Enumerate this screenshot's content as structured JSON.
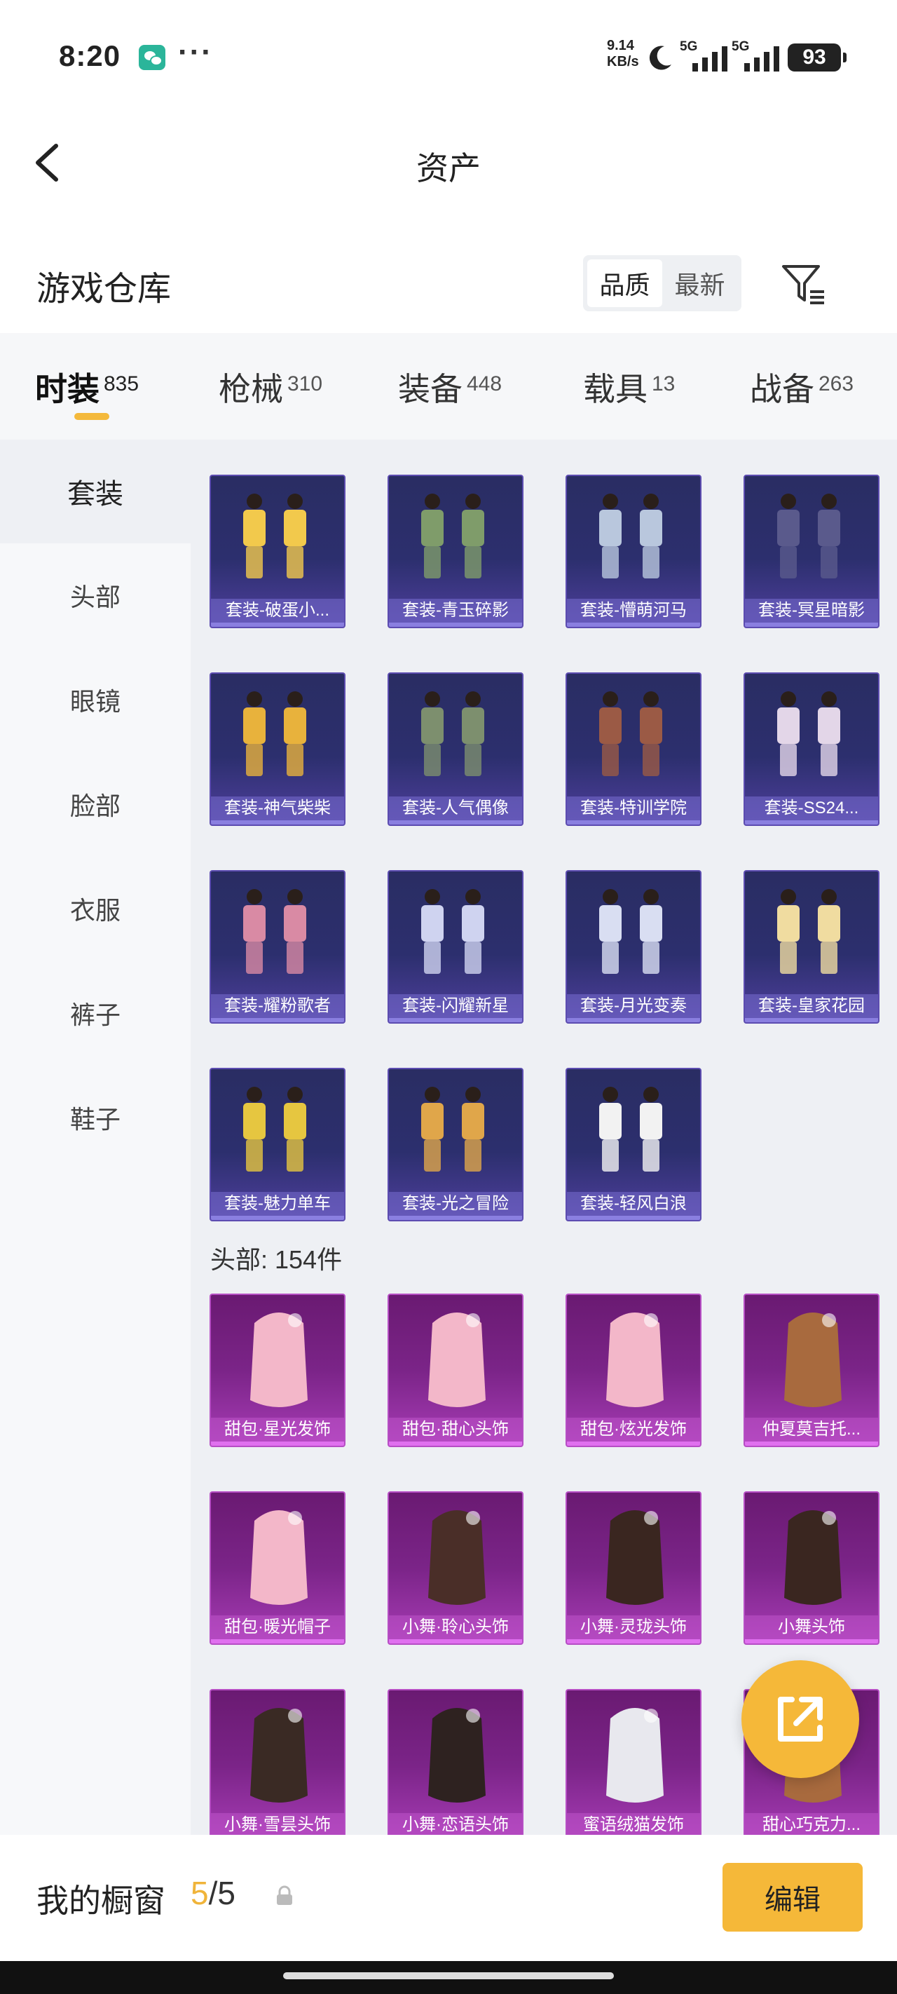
{
  "status_bar": {
    "time": "8:20",
    "dots": "···",
    "net_speed_value": "9.14",
    "net_speed_unit": "KB/s",
    "signal_1_label": "5G",
    "signal_2_label": "5G",
    "battery": "93",
    "icons": [
      "wechat-icon",
      "moon-icon",
      "signal-icon",
      "battery-icon"
    ]
  },
  "header": {
    "title": "资产",
    "back_icon": "chevron-left-icon"
  },
  "warehouse": {
    "title": "游戏仓库",
    "sort_options": [
      "品质",
      "最新"
    ],
    "sort_selected": "品质",
    "filter_icon": "filter-icon"
  },
  "tabs": [
    {
      "label": "时装",
      "count": "835",
      "active": true
    },
    {
      "label": "枪械",
      "count": "310",
      "active": false
    },
    {
      "label": "装备",
      "count": "448",
      "active": false
    },
    {
      "label": "载具",
      "count": "13",
      "active": false
    },
    {
      "label": "战备",
      "count": "263",
      "active": false
    }
  ],
  "sidebar": {
    "items": [
      {
        "label": "套装",
        "active": true
      },
      {
        "label": "头部",
        "active": false
      },
      {
        "label": "眼镜",
        "active": false
      },
      {
        "label": "脸部",
        "active": false
      },
      {
        "label": "衣服",
        "active": false
      },
      {
        "label": "裤子",
        "active": false
      },
      {
        "label": "鞋子",
        "active": false
      }
    ]
  },
  "suits": [
    "套装-破蛋小...",
    "套装-青玉碎影",
    "套装-懵萌河马",
    "套装-冥星暗影",
    "套装-神气柴柴",
    "套装-人气偶像",
    "套装-特训学院",
    "套装-SS24...",
    "套装-耀粉歌者",
    "套装-闪耀新星",
    "套装-月光变奏",
    "套装-皇家花园",
    "套装-魅力单车",
    "套装-光之冒险",
    "套装-轻风白浪"
  ],
  "head_section": {
    "label": "头部: 154件"
  },
  "head_items": [
    "甜包·星光发饰",
    "甜包·甜心头饰",
    "甜包·炫光发饰",
    "仲夏莫吉托...",
    "甜包·暖光帽子",
    "小舞·聆心头饰",
    "小舞·灵珑头饰",
    "小舞头饰",
    "小舞·雪昙头饰",
    "小舞·恋语头饰",
    "蜜语绒猫发饰",
    "甜心巧克力..."
  ],
  "fab": {
    "icon": "share-external-icon"
  },
  "bottom_bar": {
    "label": "我的橱窗",
    "count_current": "5",
    "count_separator": "/",
    "count_total": "5",
    "lock_icon": "lock-icon",
    "edit_label": "编辑"
  },
  "colors": {
    "accent": "#f5b839",
    "suit_card": "#2c2f6e",
    "head_card": "#7b2488",
    "content_bg": "#eef0f4"
  }
}
